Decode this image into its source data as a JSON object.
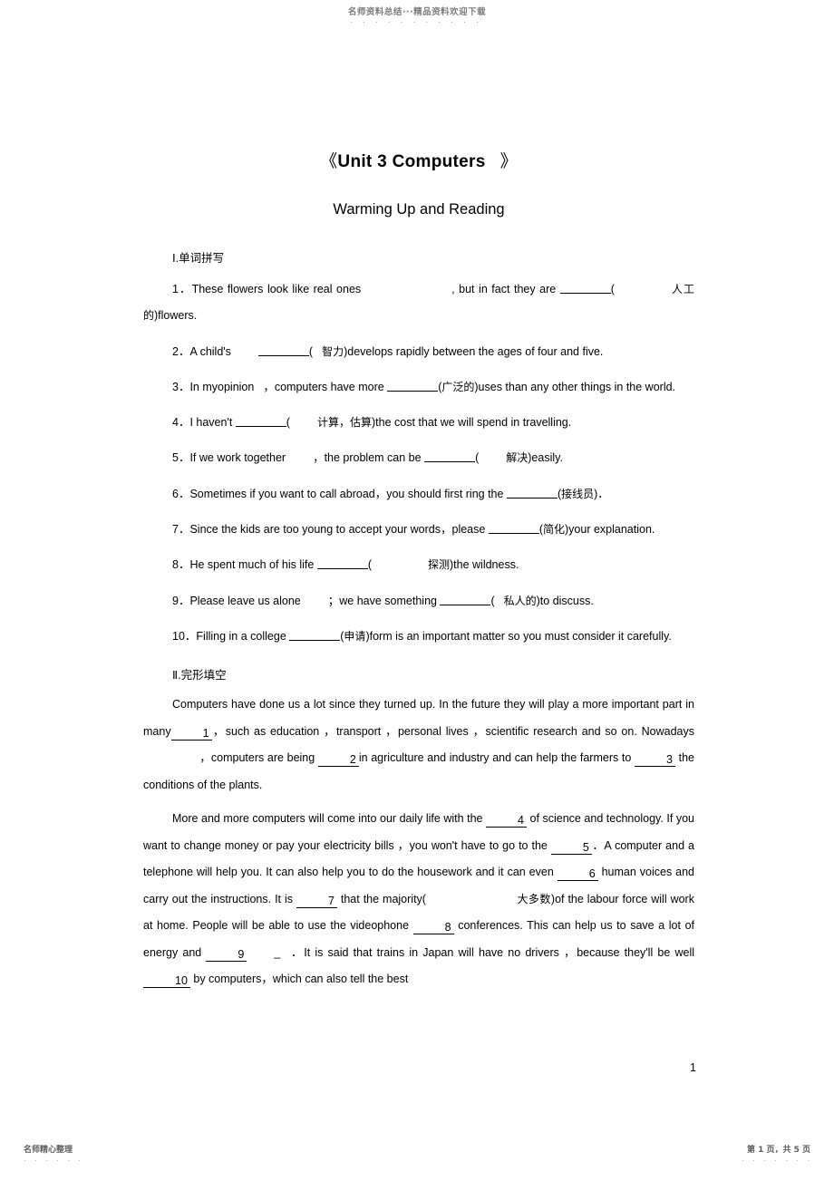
{
  "watermark": {
    "header_text": "名师资料总结···精品资料欢迎下载",
    "header_dots": "· · · · · · · · · · · · · · ·",
    "footer_left_text": "名师精心整理",
    "footer_left_dots": "· · · · · ·",
    "footer_right_text": "第 1 页，共 5 页",
    "footer_right_dots": "· · · · · · · ·"
  },
  "document": {
    "title_open_bracket": "《",
    "title": "Unit 3 Computers",
    "title_close_bracket": "》",
    "subtitle": "Warming Up and Reading",
    "page_number": "1"
  },
  "section_one": {
    "heading": "Ⅰ.单词拼写",
    "items": [
      {
        "number": "1．",
        "part1": "These flowers look like real ones",
        "part2": ", but in fact they are ",
        "hint": "人工的",
        "part3": ")flowers."
      },
      {
        "number": "2．",
        "part1": "A child's",
        "part2": "",
        "hint": "智力",
        "part3": ")develops  rapidly   between  the  ages  of  four   and five."
      },
      {
        "number": "3．",
        "part1": "In  myopinion",
        "part2": "，computers  have more ",
        "hint": "广泛的",
        "part3": ")uses  than  any other   things in the world."
      },
      {
        "number": "4．",
        "part1": "I haven't ",
        "part2": "",
        "hint": "计算，估算",
        "part3": ")the cost that we will spend in travelling."
      },
      {
        "number": "5．",
        "part1": "If we work together",
        "part2": "，the problem can be ",
        "hint": "解决",
        "part3": ")easily."
      },
      {
        "number": "6．",
        "part1": "Sometimes if  you  want to  call   abroad，you should  first    ring  the ",
        "part2": "",
        "hint": "接线员",
        "part3": ")．"
      },
      {
        "number": "7．",
        "part1": "Since  the  kids  are  too  young to  accept  your  words，please ",
        "part2": "",
        "hint": "简化",
        "part3": ")your explanation."
      },
      {
        "number": "8．",
        "part1": "He spent much of his life ",
        "part2": "",
        "hint": "探测",
        "part3": ")the wildness."
      },
      {
        "number": "9．",
        "part1": "Please leave us alone",
        "part2": "；we have something ",
        "hint": "私人的",
        "part3": ")to discuss."
      },
      {
        "number": "10．",
        "part1": "Filling    in  a college  ",
        "part2": "",
        "hint": "申请",
        "part3": ")form  is  an important   matter  so you must consider it carefully."
      }
    ]
  },
  "section_two": {
    "heading": "Ⅱ.完形填空",
    "paragraph1": {
      "t1": "Computers  have done  us a lot  since   they  turned  up. In  the  future    they  will    play  a more important    part  in  many",
      "b1": "1",
      "t2": "，such as education  ，transport   ，personal   lives  ，scientific research and so on. Nowadays",
      "t3": "，computers are being ",
      "b2": "2",
      "t4": "in agriculture and industry and can help the farmers to ",
      "b3": "3",
      "t5": " the conditions of the plants."
    },
    "paragraph2": {
      "t1": "More and more computers  will   come into   our  daily   life    with  the  ",
      "b4": "4",
      "t2": " of  science and technology.   If   you want to  change money or pay your  electricity      bills   ，you won't have  to  go to  the  ",
      "b5": "5",
      "t3": "．A computer  and a telephone   will   help  you. It  can  also  help you to do the housework and it can even ",
      "b6": "6",
      "t4": " human voices and carry out the instructions. It is ",
      "b7": "7",
      "t5": " that the majority(",
      "hint1": "大多数",
      "t6": ")of the labour force will work at  home. People  will    be able  to  use  the  videophone  ",
      "b8": "8",
      "t7": " conferences.    This  can help us to save a lot of energy and ",
      "b9": "9",
      "t8": "．It is said that trains in Japan will have no drivers  ，because they'll    be well  ",
      "b10": "10",
      "t9": " by computers，which  can also  tell   the best"
    }
  }
}
